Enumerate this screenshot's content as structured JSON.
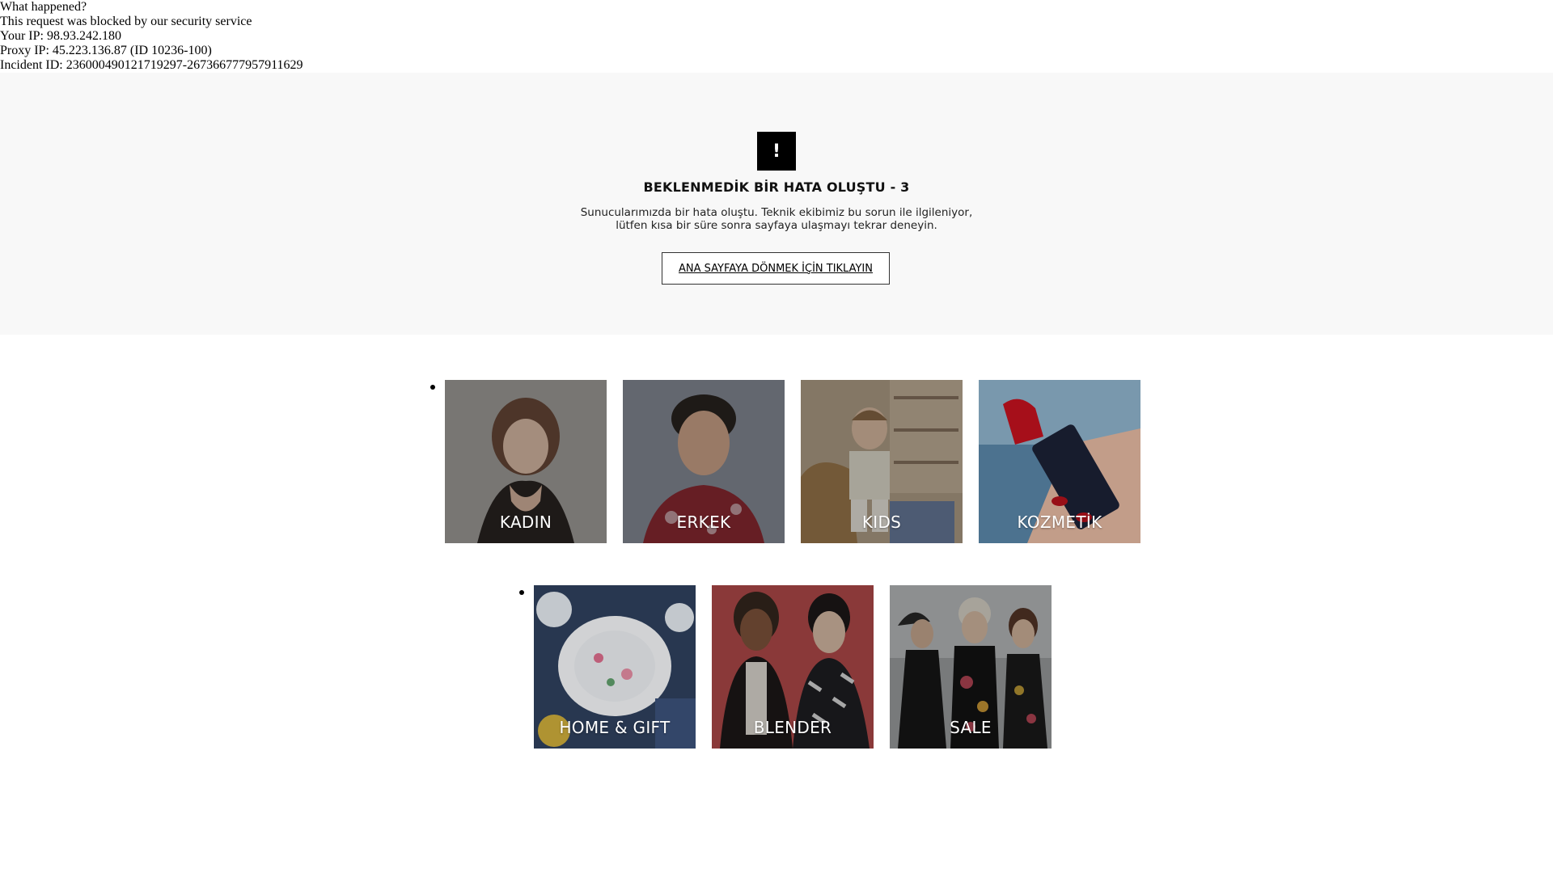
{
  "block_info": {
    "line1": "What happened?",
    "line2": "This request was blocked by our security service",
    "line3": "Your IP: 98.93.242.180",
    "line4": "Proxy IP: 45.223.136.87 (ID 10236-100)",
    "line5": "Incident ID: 236000490121719297-267366777957911629"
  },
  "error": {
    "icon_glyph": "!",
    "icon": "exclamation-icon",
    "title": "BEKLENMEDİK BİR HATA OLUŞTU - 3",
    "message_line1": "Sunucularımızda bir hata oluştu. Teknik ekibimiz bu sorun ile ilgileniyor,",
    "message_line2": "lütfen kısa bir süre sonra sayfaya ulaşmayı tekrar deneyin.",
    "home_link": "ANA SAYFAYA DÖNMEK İÇİN TIKLAYIN"
  },
  "categories": {
    "row1": [
      {
        "label": "KADIN"
      },
      {
        "label": "ERKEK"
      },
      {
        "label": "KIDS"
      },
      {
        "label": "KOZMETİK"
      }
    ],
    "row2": [
      {
        "label": "HOME & GIFT"
      },
      {
        "label": "BLENDER"
      },
      {
        "label": "SALE"
      }
    ]
  },
  "colors": {
    "panel_bg": "#f8f8f8",
    "icon_bg": "#000000",
    "tile_label": "#ffffff"
  }
}
